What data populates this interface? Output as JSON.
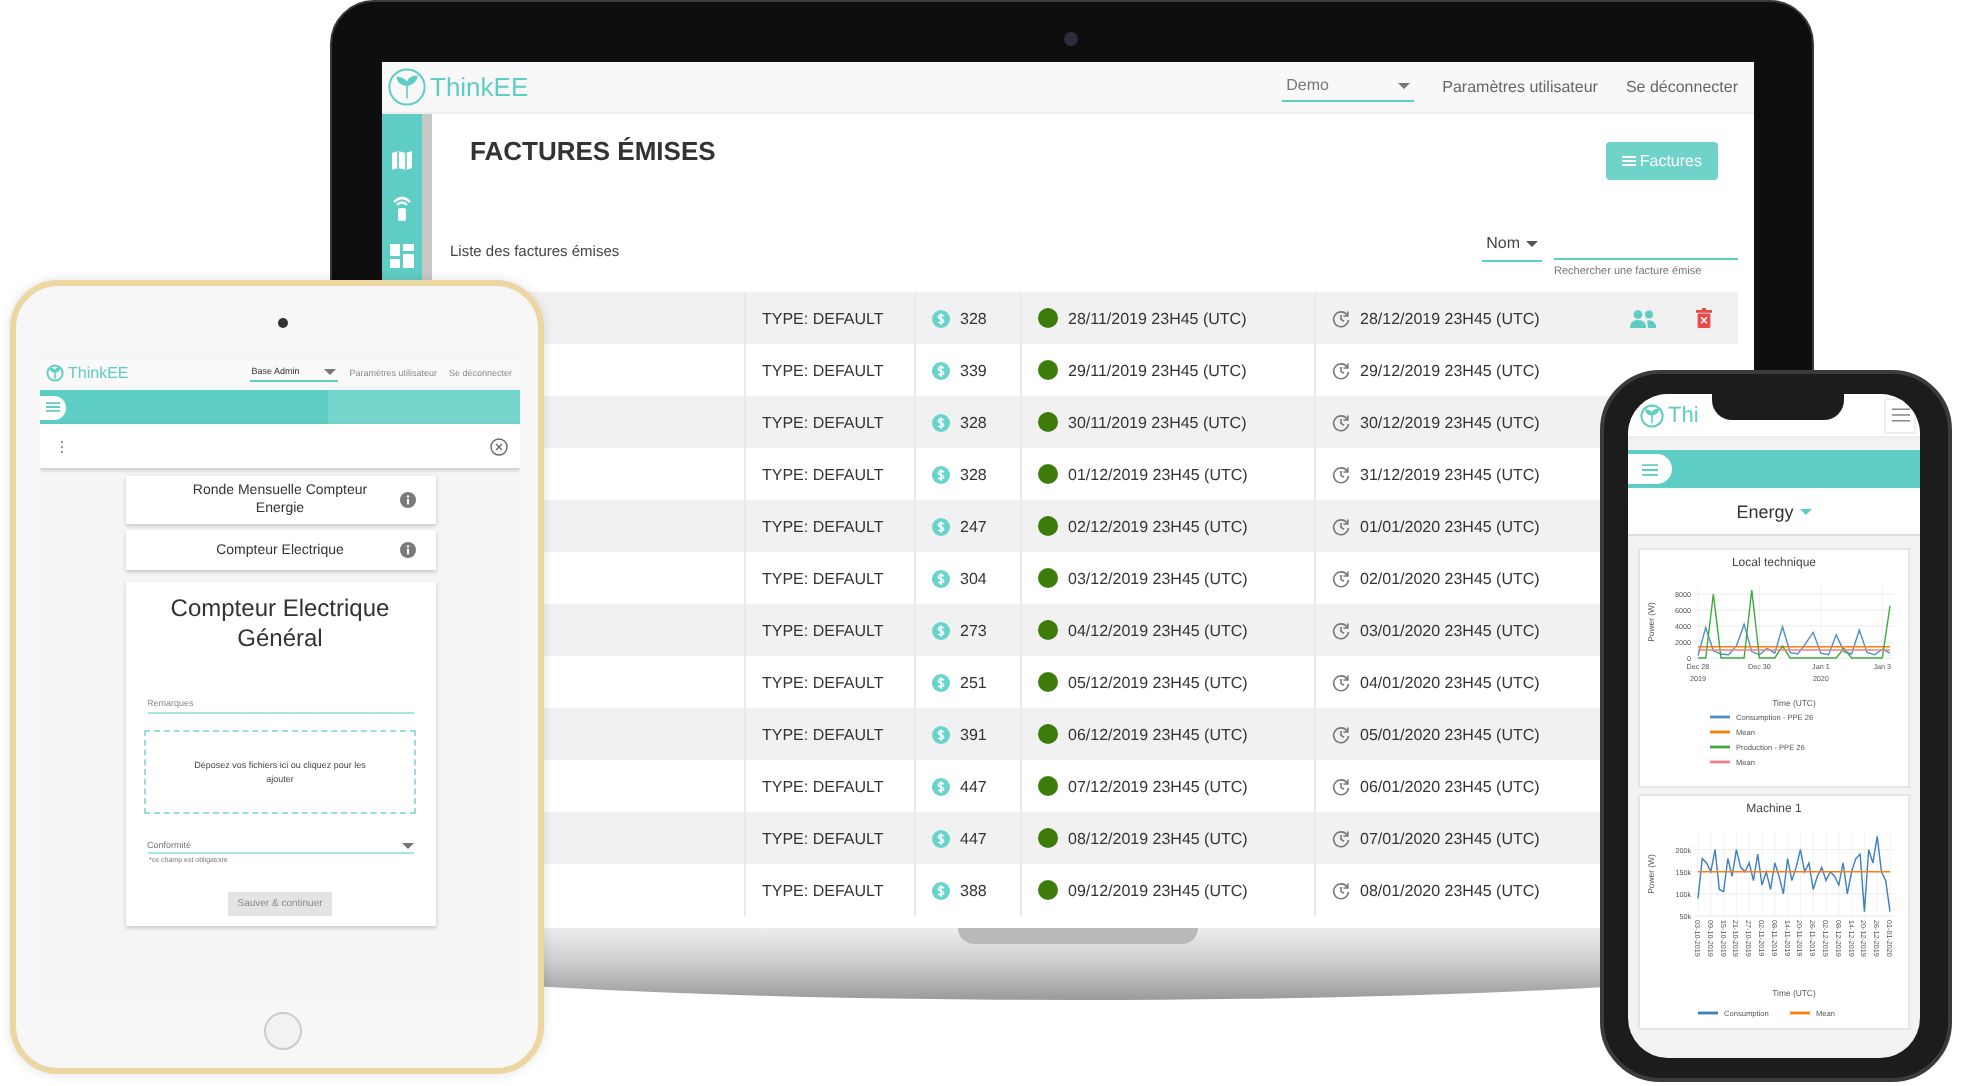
{
  "laptop": {
    "header": {
      "logo": "ThinkEE",
      "account": "Demo",
      "links": [
        "Paramètres utilisateur",
        "Se déconnecter"
      ]
    },
    "title": "FACTURES ÉMISES",
    "button": "Factures",
    "list_title": "Liste des factures émises",
    "sort": "Nom",
    "search": {
      "helper": "Rechercher une facture émise"
    },
    "rows": [
      {
        "type": "TYPE: DEFAULT",
        "amount": "328",
        "issued": "28/11/2019 23H45 (UTC)",
        "due": "28/12/2019 23H45 (UTC)",
        "actions": true
      },
      {
        "type": "TYPE: DEFAULT",
        "amount": "339",
        "issued": "29/11/2019 23H45 (UTC)",
        "due": "29/12/2019 23H45 (UTC)"
      },
      {
        "type": "TYPE: DEFAULT",
        "amount": "328",
        "issued": "30/11/2019 23H45 (UTC)",
        "due": "30/12/2019 23H45 (UTC)"
      },
      {
        "type": "TYPE: DEFAULT",
        "amount": "328",
        "issued": "01/12/2019 23H45 (UTC)",
        "due": "31/12/2019 23H45 (UTC)"
      },
      {
        "type": "TYPE: DEFAULT",
        "amount": "247",
        "issued": "02/12/2019 23H45 (UTC)",
        "due": "01/01/2020 23H45 (UTC)"
      },
      {
        "type": "TYPE: DEFAULT",
        "amount": "304",
        "issued": "03/12/2019 23H45 (UTC)",
        "due": "02/01/2020 23H45 (UTC)"
      },
      {
        "type": "TYPE: DEFAULT",
        "amount": "273",
        "issued": "04/12/2019 23H45 (UTC)",
        "due": "03/01/2020 23H45 (UTC)"
      },
      {
        "type": "TYPE: DEFAULT",
        "amount": "251",
        "issued": "05/12/2019 23H45 (UTC)",
        "due": "04/01/2020 23H45 (UTC)"
      },
      {
        "type": "TYPE: DEFAULT",
        "amount": "391",
        "issued": "06/12/2019 23H45 (UTC)",
        "due": "05/01/2020 23H45 (UTC)"
      },
      {
        "type": "TYPE: DEFAULT",
        "amount": "447",
        "issued": "07/12/2019 23H45 (UTC)",
        "due": "06/01/2020 23H45 (UTC)"
      },
      {
        "type": "TYPE: DEFAULT",
        "amount": "447",
        "issued": "08/12/2019 23H45 (UTC)",
        "due": "07/01/2020 23H45 (UTC)"
      },
      {
        "type": "TYPE: DEFAULT",
        "amount": "388",
        "issued": "09/12/2019 23H45 (UTC)",
        "due": "08/01/2020 23H45 (UTC)"
      }
    ]
  },
  "tablet": {
    "header": {
      "logo": "ThinkEE",
      "account": "Base Admin",
      "links": [
        "Paramètres utilisateur",
        "Se déconnecter"
      ]
    },
    "items": [
      {
        "label": "Ronde Mensuelle Compteur Energie"
      },
      {
        "label": "Compteur Electrique"
      }
    ],
    "form": {
      "title": "Compteur Electrique Général",
      "remarks": {
        "placeholder": "Remarques"
      },
      "dropzone": "Déposez vos fichiers ici ou cliquez pour les ajouter",
      "select": {
        "placeholder": "Conformité",
        "helper": "*ce champ est obligatoire"
      },
      "button": {
        "label": "Sauver & continuer",
        "disabled": true
      }
    }
  },
  "phone": {
    "header": {
      "logo": "Thi"
    },
    "selector": "Energy",
    "charts": [
      {
        "chart_data": {
          "type": "line",
          "title": "Local technique",
          "xlabel": "Time (UTC)",
          "ylabel": "Power (W)",
          "categories": [
            "Dec 28\n2019",
            null,
            null,
            null,
            null,
            null,
            null,
            null,
            "Dec 30",
            null,
            null,
            null,
            null,
            null,
            null,
            null,
            "Jan 1\n2020",
            null,
            null,
            null,
            null,
            null,
            null,
            null,
            "Jan 3",
            null
          ],
          "series": [
            {
              "name": "Consumption - PPE 26",
              "color": "#4f8fc9",
              "values": [
                300,
                3800,
                900,
                500,
                400,
                1500,
                4200,
                800,
                400,
                1200,
                600,
                3900,
                700,
                500,
                1800,
                3200,
                600,
                400,
                2900,
                800,
                500,
                3500,
                700,
                400,
                1100,
                600
              ]
            },
            {
              "name": "Mean",
              "color": "#ff7f0e",
              "values": [
                1400,
                1400,
                1400,
                1400,
                1400,
                1400,
                1400,
                1400,
                1400,
                1400,
                1400,
                1400,
                1400,
                1400,
                1400,
                1400,
                1400,
                1400,
                1400,
                1400,
                1400,
                1400,
                1400,
                1400,
                1400,
                1400
              ]
            },
            {
              "name": "Production - PPE 26",
              "color": "#3cab3c",
              "values": [
                0,
                0,
                8000,
                0,
                0,
                0,
                0,
                8500,
                0,
                0,
                0,
                1500,
                0,
                0,
                0,
                0,
                0,
                0,
                0,
                1200,
                0,
                0,
                0,
                0,
                0,
                6500
              ]
            },
            {
              "name": "Mean",
              "color": "#f08080",
              "values": [
                1000,
                1000,
                1000,
                1000,
                1000,
                1000,
                1000,
                1000,
                1000,
                1000,
                1000,
                1000,
                1000,
                1000,
                1000,
                1000,
                1000,
                1000,
                1000,
                1000,
                1000,
                1000,
                1000,
                1000,
                1000,
                1000
              ]
            }
          ],
          "ylim": [
            0,
            9000
          ],
          "grid": true,
          "legend": "bottom",
          "yticks": [
            0,
            2000,
            4000,
            6000,
            8000
          ]
        }
      },
      {
        "chart_data": {
          "type": "line",
          "title": "Machine 1",
          "xlabel": "Time (UTC)",
          "ylabel": "Power (W)",
          "categories": [
            "03-10-2019",
            null,
            null,
            "09-10-2019",
            null,
            null,
            "15-10-2019",
            null,
            null,
            "21-10-2019",
            null,
            null,
            "27-10-2019",
            null,
            null,
            "02-11-2019",
            null,
            null,
            "08-11-2019",
            null,
            null,
            "14-11-2019",
            null,
            null,
            "20-11-2019",
            null,
            null,
            "26-11-2019",
            null,
            null,
            "02-12-2019",
            null,
            null,
            "08-12-2019",
            null,
            null,
            "14-12-2019",
            null,
            null,
            "20-12-2019",
            null,
            null,
            "26-12-2019",
            null,
            null,
            "01-01-2020"
          ],
          "series": [
            {
              "name": "Consumption",
              "color": "#3b7fc4",
              "values": [
                90000,
                180000,
                170000,
                150000,
                200000,
                110000,
                105000,
                180000,
                140000,
                200000,
                160000,
                150000,
                170000,
                130000,
                190000,
                120000,
                150000,
                110000,
                170000,
                140000,
                100000,
                180000,
                130000,
                160000,
                200000,
                150000,
                170000,
                110000,
                140000,
                160000,
                130000,
                150000,
                140000,
                120000,
                170000,
                100000,
                150000,
                180000,
                190000,
                60000,
                200000,
                170000,
                230000,
                150000,
                130000,
                60000
              ]
            },
            {
              "name": "Mean",
              "color": "#ff7f0e",
              "values": [
                150000,
                150000,
                150000,
                150000,
                150000,
                150000,
                150000,
                150000,
                150000,
                150000,
                150000,
                150000,
                150000,
                150000,
                150000,
                150000,
                150000,
                150000,
                150000,
                150000,
                150000,
                150000,
                150000,
                150000,
                150000,
                150000,
                150000,
                150000,
                150000,
                150000,
                150000,
                150000,
                150000,
                150000,
                150000,
                150000,
                150000,
                150000,
                150000,
                150000,
                150000,
                150000,
                150000,
                150000,
                150000,
                150000
              ]
            }
          ],
          "ylim": [
            50000,
            240000
          ],
          "grid": true,
          "legend": "bottom",
          "yticks": [
            {
              "value": 50000,
              "label": "50k"
            },
            {
              "value": 100000,
              "label": "100k"
            },
            {
              "value": 150000,
              "label": "150k"
            },
            {
              "value": 200000,
              "label": "200k"
            }
          ]
        }
      }
    ]
  }
}
